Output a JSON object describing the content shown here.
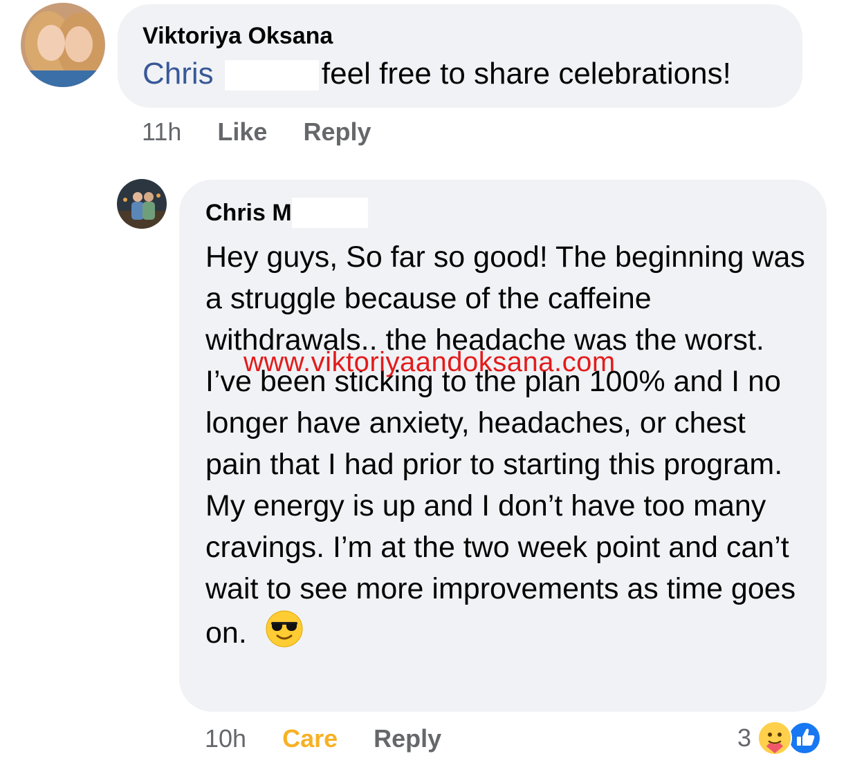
{
  "comment1": {
    "author": "Viktoriya Oksana",
    "mention": "Chris",
    "text": "feel free to share celebrations!",
    "time": "11h",
    "like_label": "Like",
    "reply_label": "Reply"
  },
  "comment2": {
    "author": "Chris M",
    "body": "Hey guys, So far so good! The beginning was a struggle because of the caffeine withdrawals.. the headache was the worst. I’ve been sticking to the plan 100% and I no longer have anxiety, headaches, or chest pain that I had prior to starting this program. My energy is up and I don’t have too many cravings. I’m at the two week point and can’t wait to see more improvements as time goes on.",
    "time": "10h",
    "care_label": "Care",
    "reply_label": "Reply",
    "reaction_count": "3",
    "reaction_icons": [
      "care-icon",
      "like-icon"
    ]
  },
  "watermark": "www.viktoriyaandoksana.com",
  "colors": {
    "bubble": "#f0f2f5",
    "mention": "#385898",
    "care": "#f7b125",
    "like": "#1877f2",
    "watermark": "#e31b1b",
    "meta": "#65676b"
  }
}
